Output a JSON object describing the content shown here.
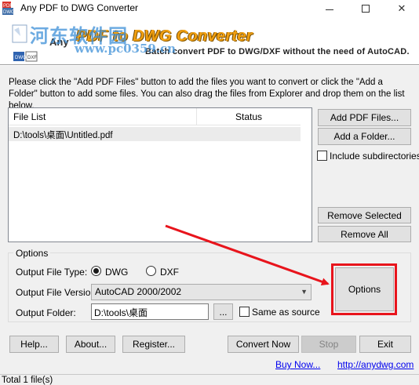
{
  "window": {
    "title": "Any PDF to DWG Converter",
    "minimize_icon": "minimize-icon",
    "maximize_icon": "maximize-icon",
    "close_icon": "close-icon",
    "close_glyph": "✕"
  },
  "banner": {
    "title": "PDF to DWG Converter",
    "prefix": "Any",
    "subtitle": "Batch convert PDF to DWG/DXF without the need of AutoCAD.",
    "watermark_text": "河东软件园",
    "watermark_url": "www.pc0359.cn",
    "title_color": "#f2a010",
    "watermark_color": "#3d8fd8"
  },
  "instructions": "Please click the \"Add PDF Files\" button to add the files you want to convert or click the \"Add a Folder\" button to add some files. You can also drag the files from Explorer and drop them on the list below.",
  "file_list": {
    "columns": [
      "File List",
      "Status"
    ],
    "rows": [
      {
        "file": "D:\\tools\\桌面\\Untitled.pdf",
        "status": ""
      }
    ]
  },
  "side_buttons": {
    "add_pdf_files": "Add PDF Files...",
    "add_folder": "Add a Folder...",
    "include_subdirectories": "Include subdirectories",
    "include_subdirectories_checked": false,
    "remove_selected": "Remove Selected",
    "remove_all": "Remove All"
  },
  "options": {
    "group_title": "Options",
    "file_type_label": "Output File Type:",
    "file_type_options": [
      "DWG",
      "DXF"
    ],
    "file_type_selected": "DWG",
    "version_label": "Output File Version:",
    "version_value": "AutoCAD 2000/2002",
    "folder_label": "Output Folder:",
    "folder_value": "D:\\tools\\桌面",
    "browse_label": "...",
    "same_as_source": "Same as source",
    "same_as_source_checked": false,
    "options_button": "Options",
    "highlight_color": "#e8141c"
  },
  "bottom_buttons": {
    "help": "Help...",
    "about": "About...",
    "register": "Register...",
    "convert_now": "Convert Now",
    "stop": "Stop",
    "exit": "Exit"
  },
  "links": {
    "buy_now": "Buy Now...",
    "website": "http://anydwg.com"
  },
  "status_bar": {
    "text": "Total 1 file(s)"
  }
}
